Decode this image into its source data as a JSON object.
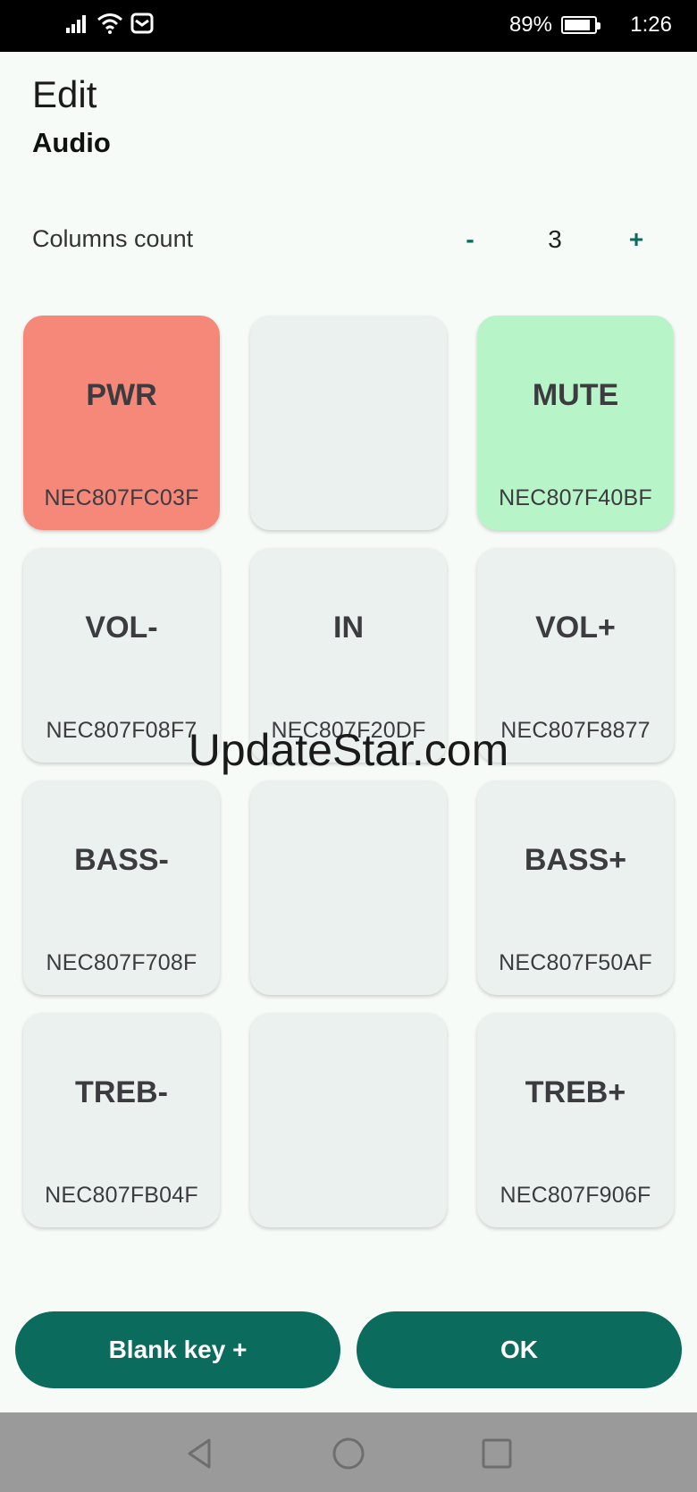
{
  "status_bar": {
    "battery_percent_text": "89%",
    "battery_level": 0.89,
    "time": "1:26",
    "icons": [
      "signal-icon",
      "wifi-icon",
      "message-icon",
      "battery-icon"
    ]
  },
  "header": {
    "title": "Edit",
    "subtitle": "Audio"
  },
  "columns": {
    "label": "Columns count",
    "minus_label": "-",
    "value": "3",
    "plus_label": "+"
  },
  "keys": [
    {
      "label": "PWR",
      "code": "NEC​807FC03F",
      "color": "#f6887a"
    },
    {
      "label": "",
      "code": "",
      "color": "#eaf1ee"
    },
    {
      "label": "MUTE",
      "code": "NEC807F40BF",
      "color": "#b7f4c8"
    },
    {
      "label": "VOL-",
      "code": "NEC807F08F7",
      "color": "#eaf1ee"
    },
    {
      "label": "IN",
      "code": "NEC807F20DF",
      "color": "#eaf1ee"
    },
    {
      "label": "VOL+",
      "code": "NEC807F8877",
      "color": "#eaf1ee"
    },
    {
      "label": "BASS-",
      "code": "NEC807F708F",
      "color": "#eaf1ee"
    },
    {
      "label": "",
      "code": "",
      "color": "#eaf1ee"
    },
    {
      "label": "BASS+",
      "code": "NEC807F50AF",
      "color": "#eaf1ee"
    },
    {
      "label": "TREB-",
      "code": "NEC807FB04F",
      "color": "#eaf1ee"
    },
    {
      "label": "",
      "code": "",
      "color": "#eaf1ee"
    },
    {
      "label": "TREB+",
      "code": "NEC807F906F",
      "color": "#eaf1ee"
    }
  ],
  "watermark": "UpdateStar.com",
  "buttons": {
    "blank_key": "Blank key +",
    "ok": "OK"
  },
  "colors": {
    "accent": "#0b6b5c",
    "background": "#f7fbf8",
    "key_default": "#eaf1ee"
  }
}
